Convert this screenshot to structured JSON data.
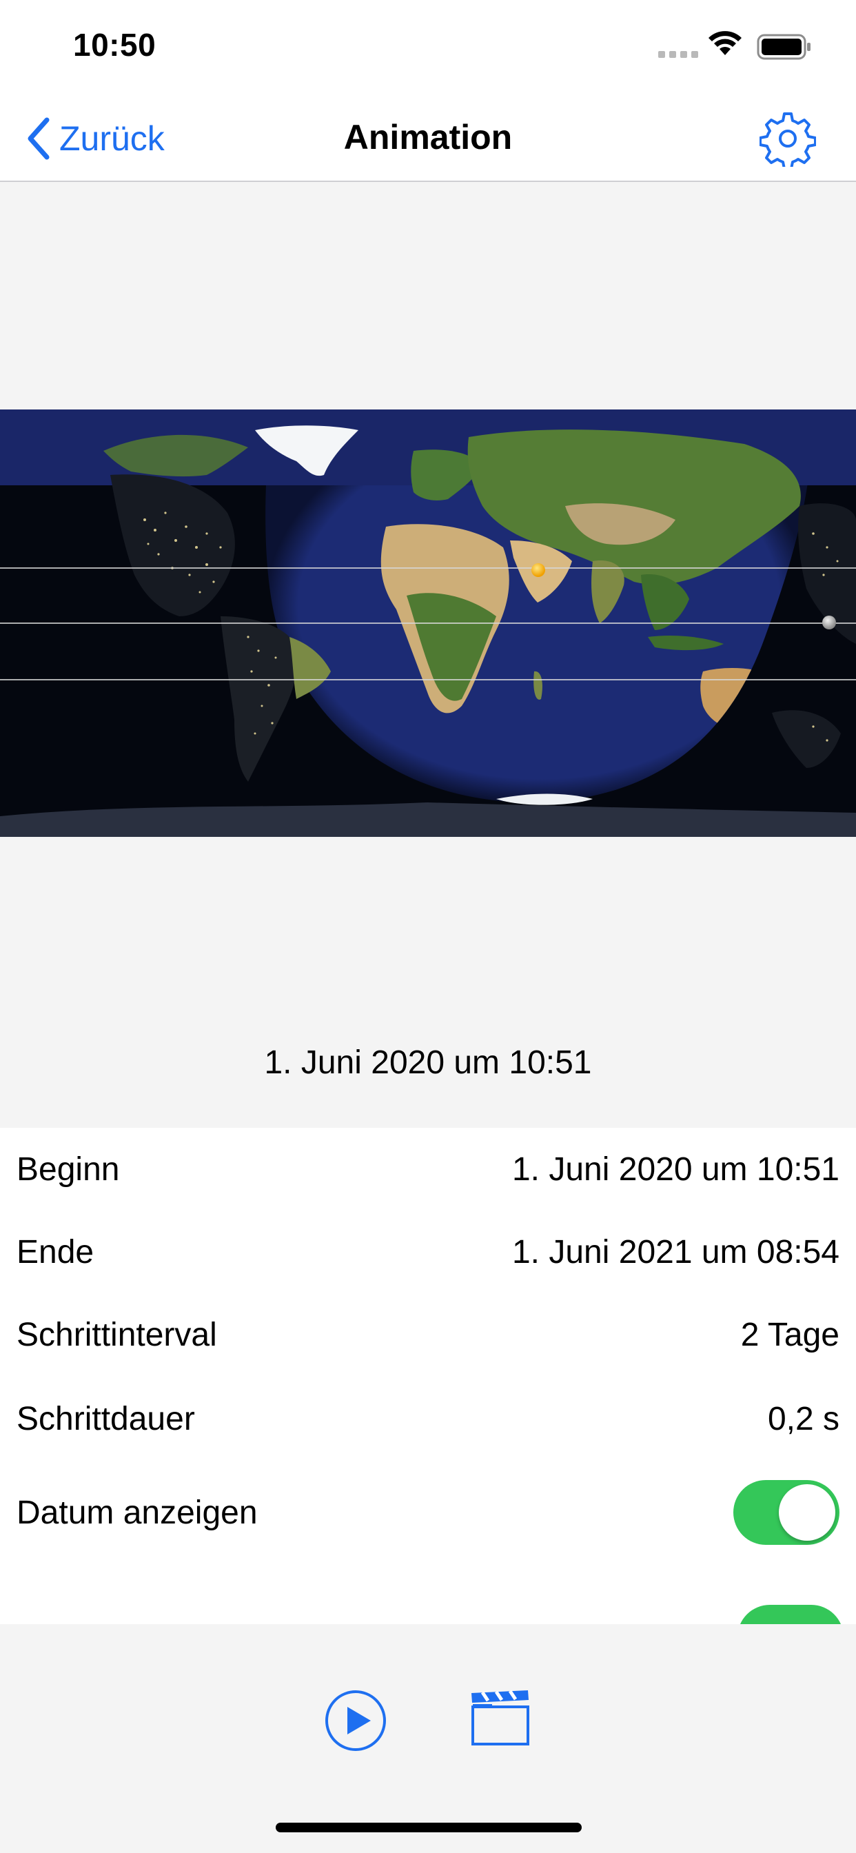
{
  "status_bar": {
    "time": "10:50"
  },
  "nav": {
    "back_label": "Zurück",
    "title": "Animation",
    "settings_icon": "gear-icon"
  },
  "map": {
    "view": "world day/night map",
    "sun_marker": "sun-icon",
    "moon_marker": "moon-icon"
  },
  "current_date": "1. Juni 2020 um 10:51",
  "settings": {
    "rows": [
      {
        "label": "Beginn",
        "value": "1. Juni 2020 um 10:51"
      },
      {
        "label": "Ende",
        "value": "1. Juni 2021 um 08:54"
      },
      {
        "label": "Schrittinterval",
        "value": "2 Tage"
      },
      {
        "label": "Schrittdauer",
        "value": "0,2 s"
      },
      {
        "label": "Datum anzeigen",
        "toggle": true
      }
    ]
  },
  "toolbar": {
    "play_icon": "play-icon",
    "clapper_icon": "clapperboard-icon"
  },
  "colors": {
    "accent": "#1e6ff0",
    "toggle_on": "#34c759",
    "ocean_day": "#1a2a6e",
    "night": "#050810"
  }
}
